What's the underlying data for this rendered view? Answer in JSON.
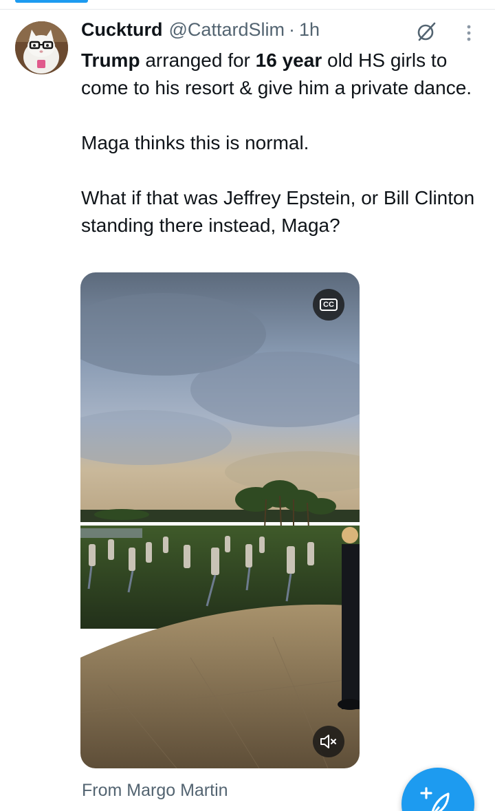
{
  "tweet": {
    "display_name": "Cuckturd",
    "handle": "@CattardSlim",
    "separator": "·",
    "time": "1h",
    "text": {
      "p1_bold_a": "Trump",
      "p1_a": " arranged for ",
      "p1_bold_b": "16 year",
      "p1_b": " old HS girls to come to his resort & give him a private dance.",
      "p2": "Maga thinks this is normal.",
      "p3": "What if that was Jeffrey Epstein, or Bill Clinton standing there instead, Maga?"
    },
    "media": {
      "cc_label": "CC",
      "mute_icon": "speaker-muted-icon"
    },
    "attribution": "From Margo Martin"
  },
  "icons": {
    "grok": "grok-icon",
    "more": "more-vertical-icon",
    "compose": "compose-post-icon"
  },
  "colors": {
    "accent": "#1d9bf0",
    "secondary_text": "#536471",
    "primary_text": "#0f1419"
  }
}
